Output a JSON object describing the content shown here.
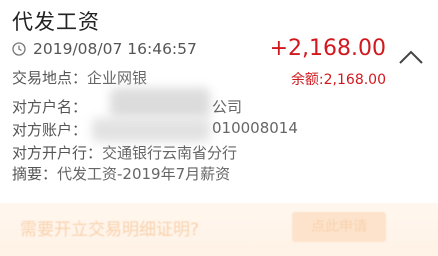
{
  "title": "代发工资",
  "datetime": "2019/08/07 16:46:57",
  "amount": "+2,168.00",
  "balance": "余额:2,168.00",
  "details": {
    "location_label": "交易地点：",
    "location_value": "企业网银",
    "payer_name_label": "对方户名：",
    "payer_name_visible": "公司",
    "payer_account_label": "对方账户：",
    "payer_account_visible": "010008014",
    "bank_label": "对方开户行：",
    "bank_value": "交通银行云南省分行",
    "memo_label": "摘要：",
    "memo_value": "代发工资-2019年7月薪资"
  },
  "banner": {
    "text": "需要开立交易明细证明?",
    "button": "点此申请"
  },
  "colors": {
    "amount": "#d0191f",
    "text": "#555555",
    "banner_bg": "#fff4ea"
  },
  "icons": [
    "clock-icon",
    "chevron-up-icon"
  ]
}
